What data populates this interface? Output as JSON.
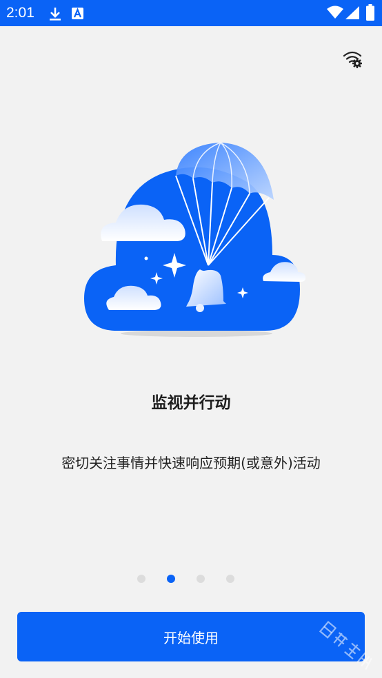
{
  "status_bar": {
    "time": "2:01",
    "icons": [
      "download-icon",
      "keyboard-a-icon",
      "wifi-icon",
      "signal-icon",
      "battery-icon"
    ],
    "background": "#0a63f6"
  },
  "settings": {
    "icon": "wifi-settings-icon"
  },
  "illustration": {
    "description_icon": "cloud-parachute-bell-icon"
  },
  "onboarding": {
    "title": "监视并行动",
    "description": "密切关注事情并快速响应预期(或意外)活动",
    "page_count": 4,
    "current_page": 2
  },
  "start_button": {
    "label": "开始使用"
  },
  "watermark": {
    "text": "日升在线"
  },
  "colors": {
    "accent": "#0a63f6",
    "background": "#f2f2f2",
    "dot_inactive": "#dcdcdc"
  }
}
